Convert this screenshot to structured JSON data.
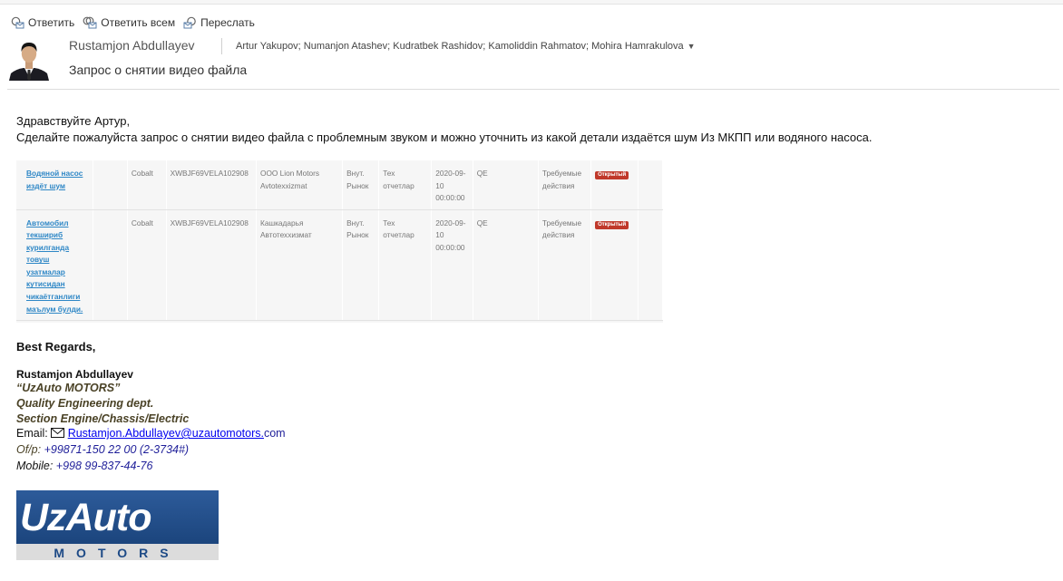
{
  "toolbar": {
    "reply": "Ответить",
    "reply_all": "Ответить всем",
    "forward": "Переслать"
  },
  "header": {
    "sender": "Rustamjon Abdullayev",
    "recipients": "Artur Yakupov; Numanjon Atashev; Kudratbek Rashidov; Kamoliddin Rahmatov; Mohira Hamrakulova",
    "subject": "Запрос о снятии видео файла"
  },
  "body": {
    "greeting": "Здравствуйте Артур,",
    "text": "Сделайте пожалуйста запрос о снятии видео файла с проблемным звуком и можно уточнить из какой детали издаётся шум Из МКПП или водяного насоса."
  },
  "embedded_table": {
    "rows": [
      {
        "title": "Водяной насос издёт шум",
        "model": "Cobalt",
        "vin": "XWBJF69VELA102908",
        "dealer": "OOO Lion Motors Avtotexxizmat",
        "market": "Внут. Рынок",
        "report": "Тех отчетлар",
        "date": "2020-09-10 00:00:00",
        "dept": "QE",
        "action": "Требуемые действия",
        "status": "Открытый"
      },
      {
        "title": "Автомобил текшириб курилганда товуш узатмалар кутисидан чикаётганлиги маълум булди.",
        "model": "Cobalt",
        "vin": "XWBJF69VELA102908",
        "dealer": "Кашкадарья Автотеххизмат",
        "market": "Внут. Рынок",
        "report": "Тех отчетлар",
        "date": "2020-09-10 00:00:00",
        "dept": "QE",
        "action": "Требуемые действия",
        "status": "Открытый"
      }
    ]
  },
  "signature": {
    "regards": "Best Regards,",
    "name": "Rustamjon Abdullayev",
    "company": "“UzAuto MOTORS”",
    "dept": "Quality Engineering dept.",
    "section": "Section Engine/Chassis/Electric",
    "email_label": "Email:",
    "email_link": "Rustamjon.Abdullayev@uzautomotors.",
    "email_tail": "com",
    "office_label": "Of/p:",
    "office_value": "+99871-150 22 00 (2-3734#)",
    "mobile_label": "Mobile:",
    "mobile_value": "+998 99-837-44-76"
  },
  "logo": {
    "brand": "UzAuto",
    "sub": "MOTORS"
  },
  "colors": {
    "link": "#2e87c6",
    "badge": "#c0392b",
    "logo_bg": "#1d4a86",
    "signature_olive": "#4a4226",
    "phone_blue": "#1f1f99"
  }
}
